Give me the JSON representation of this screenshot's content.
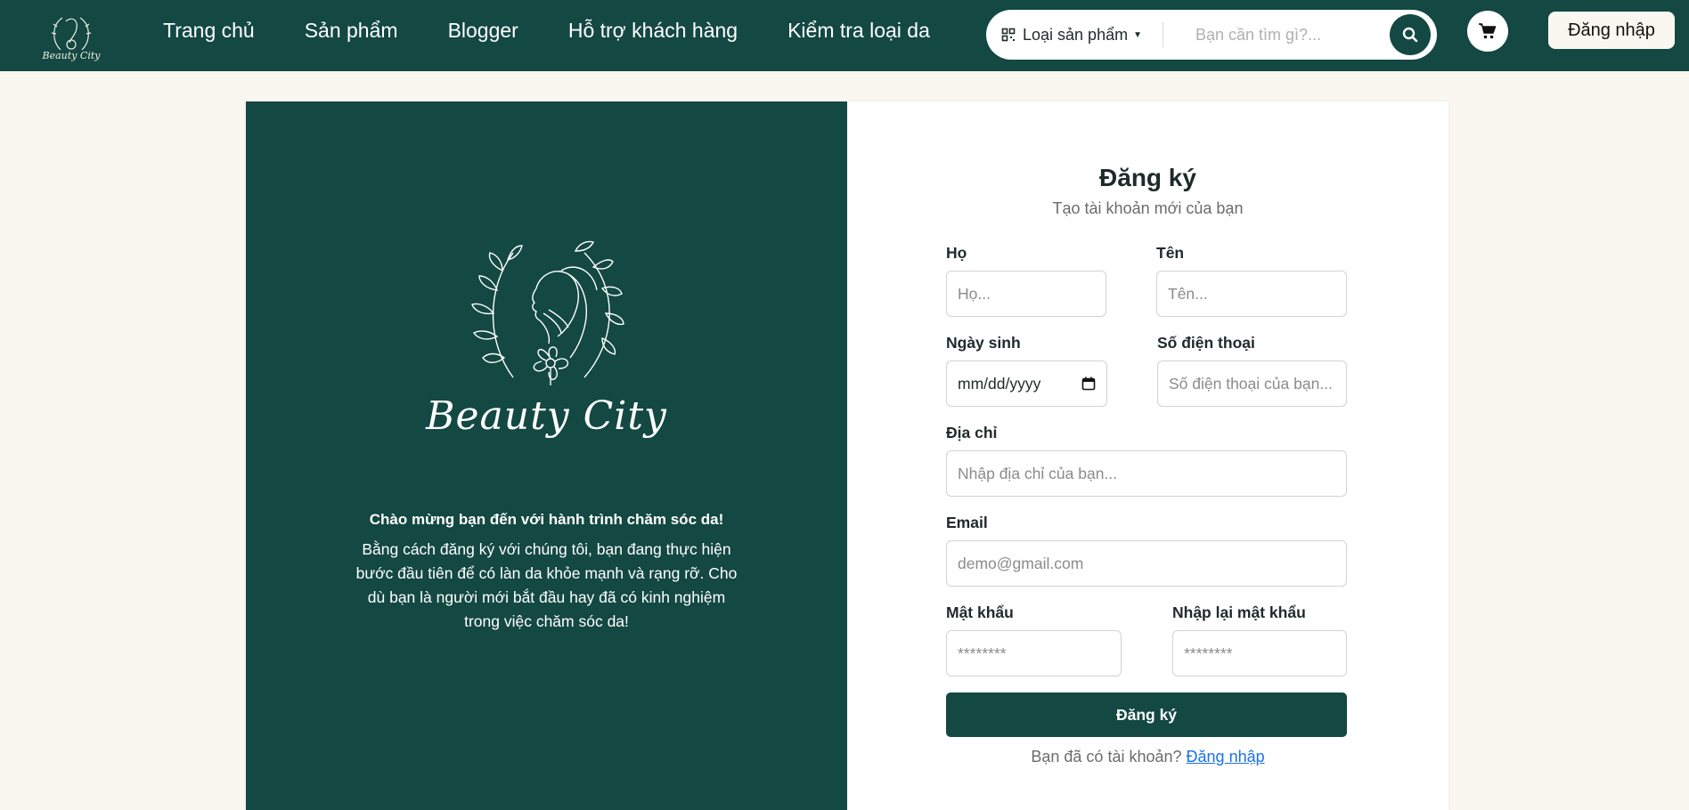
{
  "header": {
    "brand_text": "Beauty City",
    "nav": [
      {
        "label": "Trang chủ"
      },
      {
        "label": "Sản phẩm"
      },
      {
        "label": "Blogger"
      },
      {
        "label": "Hỗ trợ khách hàng"
      },
      {
        "label": "Kiểm tra loại da"
      }
    ],
    "search": {
      "category_label": "Loại sản phẩm",
      "placeholder": "Bạn cần tìm gì?..."
    },
    "login_label": "Đăng nhập"
  },
  "left_panel": {
    "logo_text": "Beauty City",
    "welcome_title": "Chào mừng bạn đến với hành trình chăm sóc da!",
    "welcome_text": "Bằng cách đăng ký với chúng tôi, bạn đang thực hiện bước đầu tiên để có làn da khỏe mạnh và rạng rỡ. Cho dù bạn là người mới bắt đầu hay đã có kinh nghiệm trong việc chăm sóc da!"
  },
  "form": {
    "title": "Đăng ký",
    "subtitle": "Tạo tài khoản mới của bạn",
    "last_name": {
      "label": "Họ",
      "placeholder": "Họ..."
    },
    "first_name": {
      "label": "Tên",
      "placeholder": "Tên..."
    },
    "birthday": {
      "label": "Ngày sinh",
      "value": "mm/dd/yyyy"
    },
    "phone": {
      "label": "Số điện thoại",
      "placeholder": "Số điện thoại của bạn..."
    },
    "address": {
      "label": "Địa chỉ",
      "placeholder": "Nhập địa chỉ của bạn..."
    },
    "email": {
      "label": "Email",
      "placeholder": "demo@gmail.com"
    },
    "password": {
      "label": "Mật khẩu",
      "placeholder": "********"
    },
    "confirm_password": {
      "label": "Nhập lại mật khẩu",
      "placeholder": "********"
    },
    "submit_label": "Đăng ký",
    "footer_text": "Bạn đã có tài khoản?",
    "footer_link": "Đăng nhập"
  },
  "colors": {
    "primary": "#134843",
    "background": "#faf6f0",
    "link": "#1a73e8"
  }
}
